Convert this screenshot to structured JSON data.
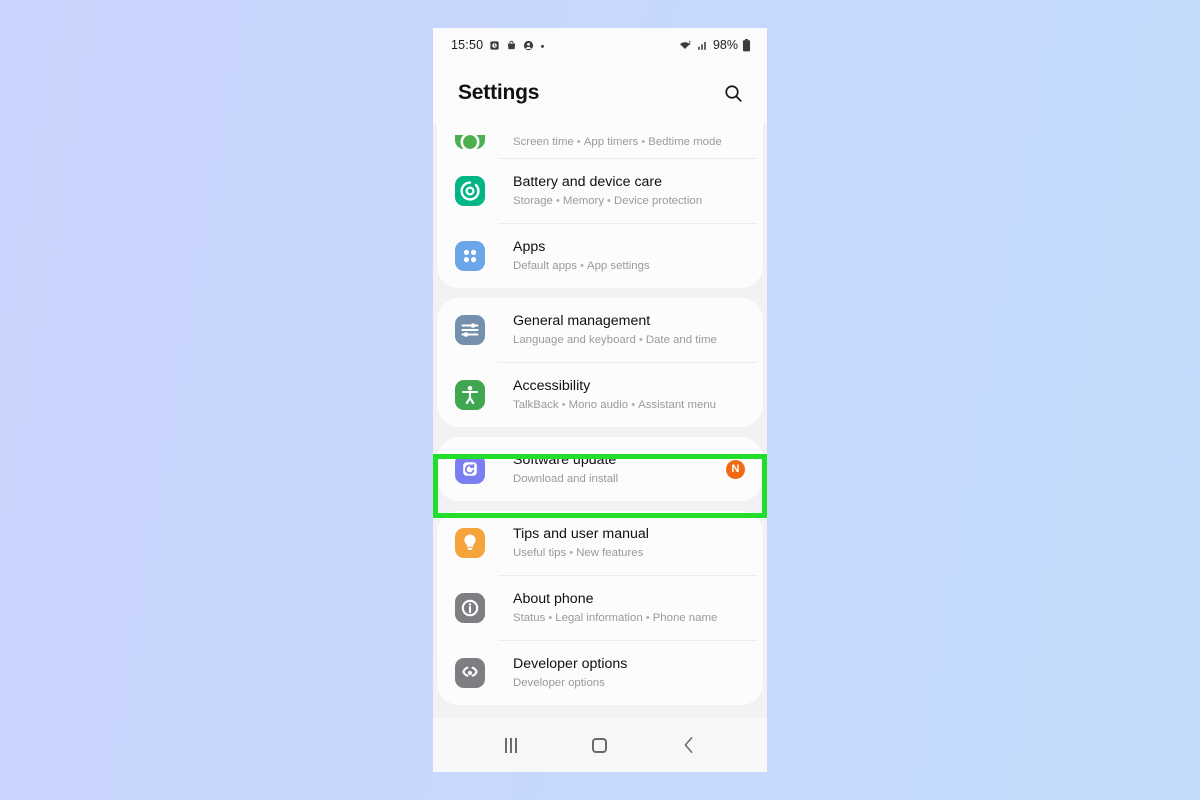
{
  "status_bar": {
    "time": "15:50",
    "left_icons": [
      "alarm-icon",
      "bag-icon",
      "profile-icon",
      "dot-icon"
    ],
    "battery_percent": "98%",
    "right_icons": [
      "wifi-icon",
      "signal-icon",
      "battery-icon"
    ]
  },
  "header": {
    "title": "Settings",
    "search_icon": "search-icon"
  },
  "groups": [
    {
      "id": "group-1",
      "items": [
        {
          "title": "",
          "subtitle_parts": [
            "Screen time",
            "App timers",
            "Bedtime mode"
          ],
          "icon": "digital-wellbeing-icon",
          "icon_color": "#4caf50",
          "partial": true,
          "badge": ""
        },
        {
          "title": "Battery and device care",
          "subtitle_parts": [
            "Storage",
            "Memory",
            "Device protection"
          ],
          "icon": "battery-device-care-icon",
          "icon_color": "#00b686",
          "partial": false,
          "badge": ""
        },
        {
          "title": "Apps",
          "subtitle_parts": [
            "Default apps",
            "App settings"
          ],
          "icon": "apps-icon",
          "icon_color": "#6ba7e8",
          "partial": false,
          "badge": ""
        }
      ]
    },
    {
      "id": "group-2",
      "items": [
        {
          "title": "General management",
          "subtitle_parts": [
            "Language and keyboard",
            "Date and time"
          ],
          "icon": "general-management-icon",
          "icon_color": "#7590ac",
          "partial": false,
          "badge": ""
        },
        {
          "title": "Accessibility",
          "subtitle_parts": [
            "TalkBack",
            "Mono audio",
            "Assistant menu"
          ],
          "icon": "accessibility-icon",
          "icon_color": "#3fa74f",
          "partial": false,
          "badge": ""
        }
      ]
    },
    {
      "id": "group-3",
      "items": [
        {
          "title": "Software update",
          "subtitle_parts": [
            "Download and install"
          ],
          "icon": "software-update-icon",
          "icon_color": "#7b7ef0",
          "partial": false,
          "badge": "N"
        }
      ]
    },
    {
      "id": "group-4",
      "items": [
        {
          "title": "Tips and user manual",
          "subtitle_parts": [
            "Useful tips",
            "New features"
          ],
          "icon": "tips-bulb-icon",
          "icon_color": "#f5a43c",
          "partial": false,
          "badge": ""
        },
        {
          "title": "About phone",
          "subtitle_parts": [
            "Status",
            "Legal information",
            "Phone name"
          ],
          "icon": "about-phone-info-icon",
          "icon_color": "#7e7e82",
          "partial": false,
          "badge": ""
        },
        {
          "title": "Developer options",
          "subtitle_parts": [
            "Developer options"
          ],
          "icon": "developer-options-icon",
          "icon_color": "#7e7e82",
          "partial": false,
          "badge": ""
        }
      ]
    }
  ],
  "highlight": {
    "target": "Software update",
    "color": "#22dd2b"
  },
  "nav_bar": {
    "recents_label": "recents-icon",
    "home_label": "home-icon",
    "back_label": "back-icon"
  },
  "background": {
    "gradient_from": "#c9d3fd",
    "gradient_to": "#c3dcfc"
  }
}
